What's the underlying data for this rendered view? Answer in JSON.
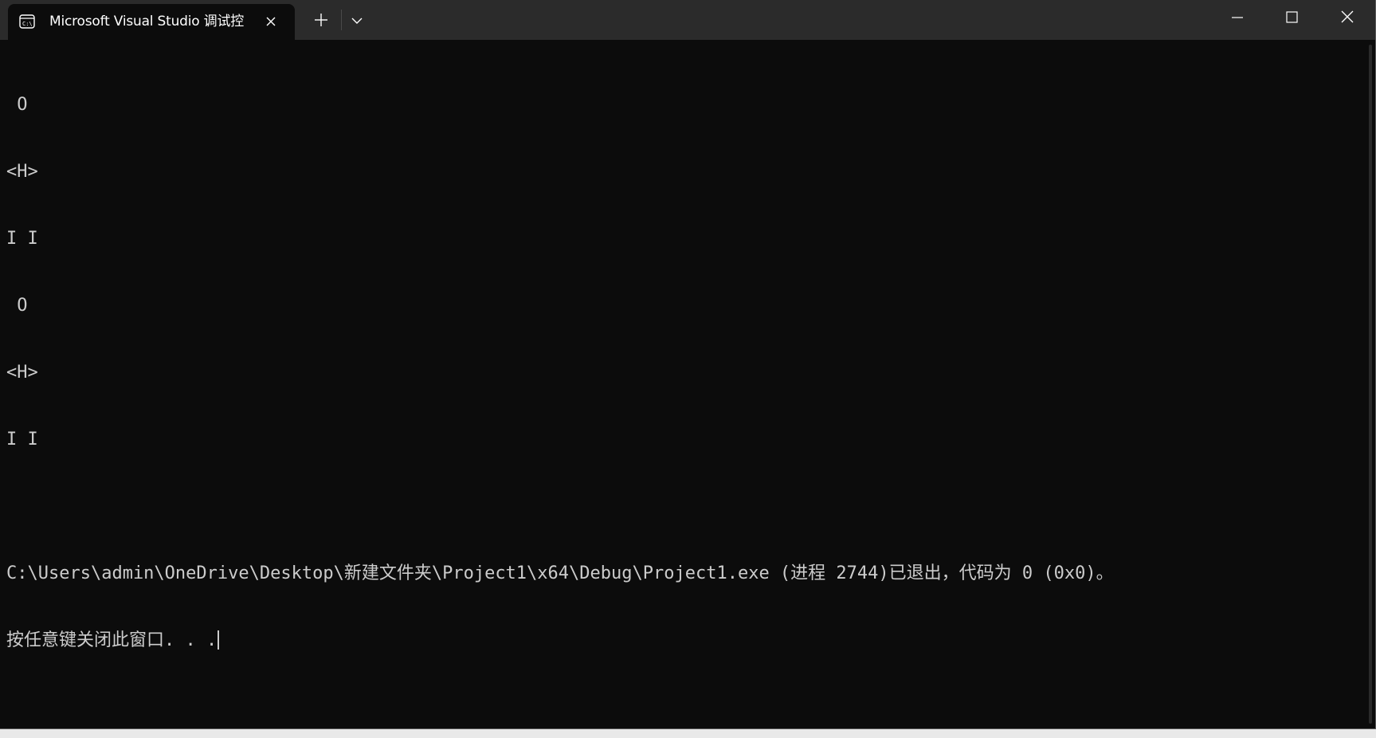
{
  "window": {
    "tab_title": "Microsoft Visual Studio 调试控",
    "tab_icon": "console-app-icon",
    "buttons": {
      "close_tab": "close-icon",
      "new_tab": "plus-icon",
      "tab_dropdown": "chevron-down-icon",
      "minimize": "minimize-icon",
      "maximize": "maximize-icon",
      "close_window": "close-icon"
    }
  },
  "console": {
    "lines": [
      " O",
      "<H>",
      "I I",
      " O",
      "<H>",
      "I I",
      "",
      "C:\\Users\\admin\\OneDrive\\Desktop\\新建文件夹\\Project1\\x64\\Debug\\Project1.exe (进程 2744)已退出，代码为 0 (0x0)。",
      "按任意键关闭此窗口. . ."
    ]
  },
  "colors": {
    "terminal_background": "#0c0c0c",
    "titlebar_background": "#2b2b2b",
    "text": "#cccccc"
  }
}
